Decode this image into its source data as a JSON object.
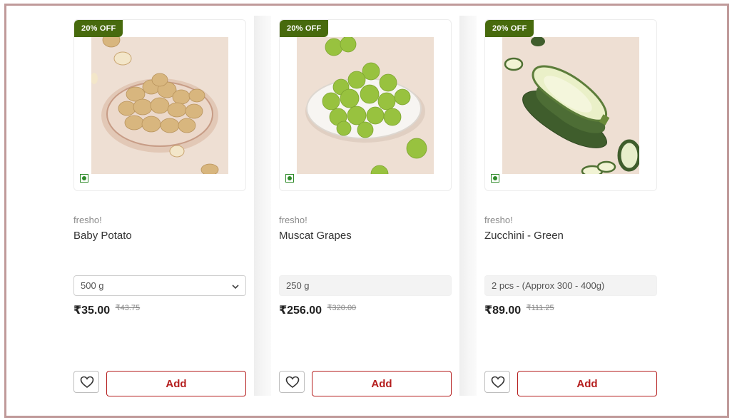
{
  "products": [
    {
      "badge": "20% OFF",
      "brand": "fresho!",
      "name": "Baby Potato",
      "pack": "500 g",
      "pack_type": "select",
      "price": "₹35.00",
      "mrp": "₹43.75",
      "add_label": "Add",
      "image_icon": "baby-potato-image"
    },
    {
      "badge": "20% OFF",
      "brand": "fresho!",
      "name": "Muscat Grapes",
      "pack": "250 g",
      "pack_type": "static",
      "price": "₹256.00",
      "mrp": "₹320.00",
      "add_label": "Add",
      "image_icon": "muscat-grapes-image"
    },
    {
      "badge": "20% OFF",
      "brand": "fresho!",
      "name": "Zucchini - Green",
      "pack": "2 pcs - (Approx 300 - 400g)",
      "pack_type": "static",
      "price": "₹89.00",
      "mrp": "₹111.25",
      "add_label": "Add",
      "image_icon": "zucchini-image"
    }
  ],
  "colors": {
    "badge": "#476a0d",
    "veg_mark": "#2f8b2a",
    "add_button": "#b51e1e",
    "frame_border": "#c09a9a"
  }
}
